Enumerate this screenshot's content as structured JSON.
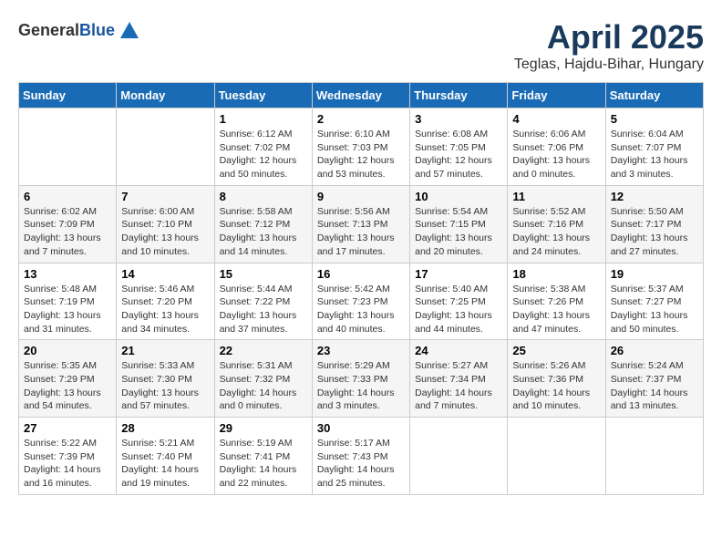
{
  "header": {
    "logo_general": "General",
    "logo_blue": "Blue",
    "month_title": "April 2025",
    "location": "Teglas, Hajdu-Bihar, Hungary"
  },
  "weekdays": [
    "Sunday",
    "Monday",
    "Tuesday",
    "Wednesday",
    "Thursday",
    "Friday",
    "Saturday"
  ],
  "weeks": [
    [
      {
        "day": "",
        "info": ""
      },
      {
        "day": "",
        "info": ""
      },
      {
        "day": "1",
        "info": "Sunrise: 6:12 AM\nSunset: 7:02 PM\nDaylight: 12 hours and 50 minutes."
      },
      {
        "day": "2",
        "info": "Sunrise: 6:10 AM\nSunset: 7:03 PM\nDaylight: 12 hours and 53 minutes."
      },
      {
        "day": "3",
        "info": "Sunrise: 6:08 AM\nSunset: 7:05 PM\nDaylight: 12 hours and 57 minutes."
      },
      {
        "day": "4",
        "info": "Sunrise: 6:06 AM\nSunset: 7:06 PM\nDaylight: 13 hours and 0 minutes."
      },
      {
        "day": "5",
        "info": "Sunrise: 6:04 AM\nSunset: 7:07 PM\nDaylight: 13 hours and 3 minutes."
      }
    ],
    [
      {
        "day": "6",
        "info": "Sunrise: 6:02 AM\nSunset: 7:09 PM\nDaylight: 13 hours and 7 minutes."
      },
      {
        "day": "7",
        "info": "Sunrise: 6:00 AM\nSunset: 7:10 PM\nDaylight: 13 hours and 10 minutes."
      },
      {
        "day": "8",
        "info": "Sunrise: 5:58 AM\nSunset: 7:12 PM\nDaylight: 13 hours and 14 minutes."
      },
      {
        "day": "9",
        "info": "Sunrise: 5:56 AM\nSunset: 7:13 PM\nDaylight: 13 hours and 17 minutes."
      },
      {
        "day": "10",
        "info": "Sunrise: 5:54 AM\nSunset: 7:15 PM\nDaylight: 13 hours and 20 minutes."
      },
      {
        "day": "11",
        "info": "Sunrise: 5:52 AM\nSunset: 7:16 PM\nDaylight: 13 hours and 24 minutes."
      },
      {
        "day": "12",
        "info": "Sunrise: 5:50 AM\nSunset: 7:17 PM\nDaylight: 13 hours and 27 minutes."
      }
    ],
    [
      {
        "day": "13",
        "info": "Sunrise: 5:48 AM\nSunset: 7:19 PM\nDaylight: 13 hours and 31 minutes."
      },
      {
        "day": "14",
        "info": "Sunrise: 5:46 AM\nSunset: 7:20 PM\nDaylight: 13 hours and 34 minutes."
      },
      {
        "day": "15",
        "info": "Sunrise: 5:44 AM\nSunset: 7:22 PM\nDaylight: 13 hours and 37 minutes."
      },
      {
        "day": "16",
        "info": "Sunrise: 5:42 AM\nSunset: 7:23 PM\nDaylight: 13 hours and 40 minutes."
      },
      {
        "day": "17",
        "info": "Sunrise: 5:40 AM\nSunset: 7:25 PM\nDaylight: 13 hours and 44 minutes."
      },
      {
        "day": "18",
        "info": "Sunrise: 5:38 AM\nSunset: 7:26 PM\nDaylight: 13 hours and 47 minutes."
      },
      {
        "day": "19",
        "info": "Sunrise: 5:37 AM\nSunset: 7:27 PM\nDaylight: 13 hours and 50 minutes."
      }
    ],
    [
      {
        "day": "20",
        "info": "Sunrise: 5:35 AM\nSunset: 7:29 PM\nDaylight: 13 hours and 54 minutes."
      },
      {
        "day": "21",
        "info": "Sunrise: 5:33 AM\nSunset: 7:30 PM\nDaylight: 13 hours and 57 minutes."
      },
      {
        "day": "22",
        "info": "Sunrise: 5:31 AM\nSunset: 7:32 PM\nDaylight: 14 hours and 0 minutes."
      },
      {
        "day": "23",
        "info": "Sunrise: 5:29 AM\nSunset: 7:33 PM\nDaylight: 14 hours and 3 minutes."
      },
      {
        "day": "24",
        "info": "Sunrise: 5:27 AM\nSunset: 7:34 PM\nDaylight: 14 hours and 7 minutes."
      },
      {
        "day": "25",
        "info": "Sunrise: 5:26 AM\nSunset: 7:36 PM\nDaylight: 14 hours and 10 minutes."
      },
      {
        "day": "26",
        "info": "Sunrise: 5:24 AM\nSunset: 7:37 PM\nDaylight: 14 hours and 13 minutes."
      }
    ],
    [
      {
        "day": "27",
        "info": "Sunrise: 5:22 AM\nSunset: 7:39 PM\nDaylight: 14 hours and 16 minutes."
      },
      {
        "day": "28",
        "info": "Sunrise: 5:21 AM\nSunset: 7:40 PM\nDaylight: 14 hours and 19 minutes."
      },
      {
        "day": "29",
        "info": "Sunrise: 5:19 AM\nSunset: 7:41 PM\nDaylight: 14 hours and 22 minutes."
      },
      {
        "day": "30",
        "info": "Sunrise: 5:17 AM\nSunset: 7:43 PM\nDaylight: 14 hours and 25 minutes."
      },
      {
        "day": "",
        "info": ""
      },
      {
        "day": "",
        "info": ""
      },
      {
        "day": "",
        "info": ""
      }
    ]
  ]
}
